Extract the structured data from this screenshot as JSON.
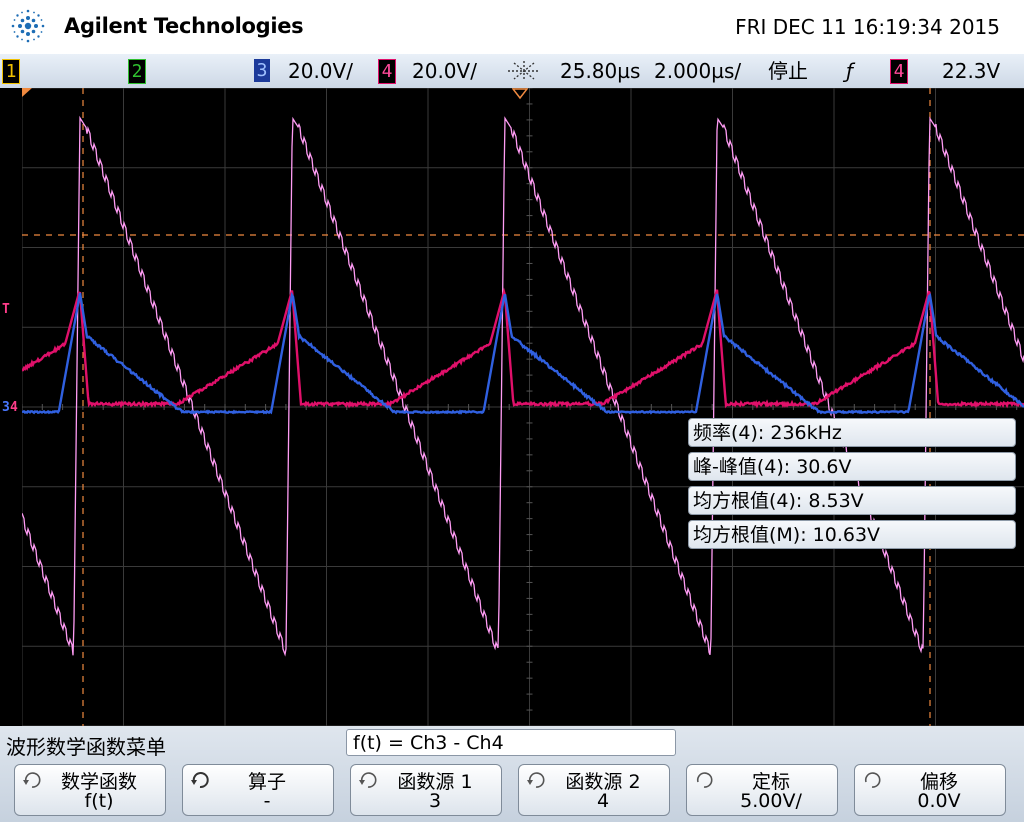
{
  "header": {
    "brand": "Agilent Technologies",
    "datetime": "FRI DEC 11 16:19:34 2015"
  },
  "status": {
    "ch1_label": "1",
    "ch2_label": "2",
    "ch3_label": "3",
    "ch3_scale": "20.0V/",
    "ch4_label": "4",
    "ch4_scale": "20.0V/",
    "delay": "25.80µs",
    "timebase": "2.000µs/",
    "run_state": "停止",
    "trigger_slope": "ƒ",
    "trigger_source": "4",
    "trigger_level": "22.3V",
    "colors": {
      "ch1": "#f0c000",
      "ch2": "#2fc02f",
      "ch3": "#3060e0",
      "ch4": "#e0106a",
      "math": "#ff9cf4",
      "trigger": "#f08a40"
    }
  },
  "measurements": [
    {
      "label": "频率(4): 236kHz"
    },
    {
      "label": "峰-峰值(4): 30.6V"
    },
    {
      "label": "均方根值(4): 8.53V"
    },
    {
      "label": "均方根值(M): 10.63V"
    }
  ],
  "markers": {
    "trigger": "T",
    "ch3": "3",
    "ch4": "4"
  },
  "menu": {
    "title": "波形数学函数菜单",
    "formula": "f(t) = Ch3 - Ch4",
    "softkeys": [
      {
        "label": "数学函数",
        "value": "f(t)"
      },
      {
        "label": "算子",
        "value": "-"
      },
      {
        "label": "函数源 1",
        "value": "3"
      },
      {
        "label": "函数源 2",
        "value": "4"
      },
      {
        "label": "定标",
        "value": "5.00V/"
      },
      {
        "label": "偏移",
        "value": "0.0V"
      }
    ]
  }
}
